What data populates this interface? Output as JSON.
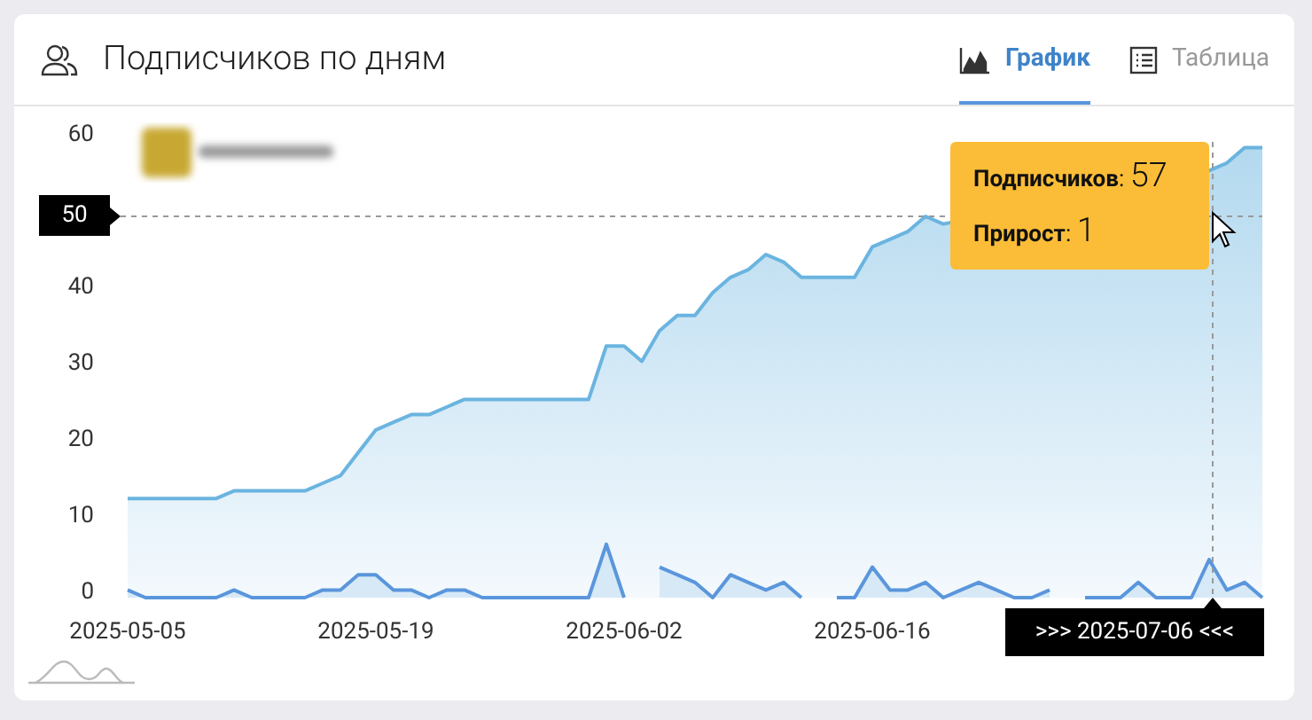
{
  "header": {
    "title": "Подписчиков по дням"
  },
  "tabs": [
    {
      "label": "График",
      "kind": "chart",
      "selected": true
    },
    {
      "label": "Таблица",
      "kind": "table",
      "selected": false
    }
  ],
  "chart_data": {
    "type": "area",
    "categories": [
      "2025-05-05",
      null,
      null,
      null,
      null,
      null,
      null,
      null,
      null,
      null,
      null,
      null,
      null,
      null,
      "2025-05-19",
      null,
      null,
      null,
      null,
      null,
      null,
      null,
      null,
      null,
      null,
      null,
      null,
      null,
      "2025-06-02",
      null,
      null,
      null,
      null,
      null,
      null,
      null,
      null,
      null,
      null,
      null,
      null,
      null,
      "2025-06-16",
      null,
      null,
      null,
      null,
      null,
      null,
      null,
      null,
      null,
      null,
      null,
      null,
      null,
      null,
      null,
      null,
      null,
      null,
      null,
      null,
      null,
      null
    ],
    "series": [
      {
        "color": "#6ab4e0",
        "values": [
          13,
          13,
          13,
          13,
          13,
          13,
          14,
          14,
          14,
          14,
          14,
          15,
          16,
          19,
          22,
          23,
          24,
          24,
          25,
          26,
          26,
          26,
          26,
          26,
          26,
          26,
          26,
          33,
          33,
          31,
          35,
          37,
          37,
          40,
          42,
          43,
          45,
          44,
          42,
          42,
          42,
          42,
          46,
          47,
          48,
          50,
          49,
          null,
          null,
          null,
          null,
          null,
          null,
          null,
          null,
          null,
          null,
          null,
          null,
          null,
          null,
          56,
          57,
          59,
          59
        ]
      },
      {
        "color": "#5a96dc",
        "values": [
          1,
          0,
          0,
          0,
          0,
          0,
          1,
          0,
          0,
          0,
          0,
          1,
          1,
          3,
          3,
          1,
          1,
          0,
          1,
          1,
          0,
          0,
          0,
          0,
          0,
          0,
          0,
          7,
          0,
          null,
          4,
          3,
          2,
          0,
          3,
          2,
          1,
          2,
          0,
          null,
          0,
          0,
          4,
          1,
          1,
          2,
          0,
          1,
          2,
          1,
          0,
          0,
          1,
          null,
          0,
          0,
          0,
          2,
          0,
          0,
          0,
          5,
          1,
          2,
          0
        ]
      }
    ],
    "ylim": [
      0,
      60
    ],
    "yticks": [
      0,
      10,
      20,
      30,
      40,
      50,
      60
    ]
  },
  "crosshair": {
    "y_label": "50",
    "x_label": ">>> 2025-07-06 <<<"
  },
  "tooltip": [
    {
      "label": "**Подписчиков**:",
      "value": "57"
    },
    {
      "label": "**Прирост**:",
      "value": "1"
    }
  ]
}
